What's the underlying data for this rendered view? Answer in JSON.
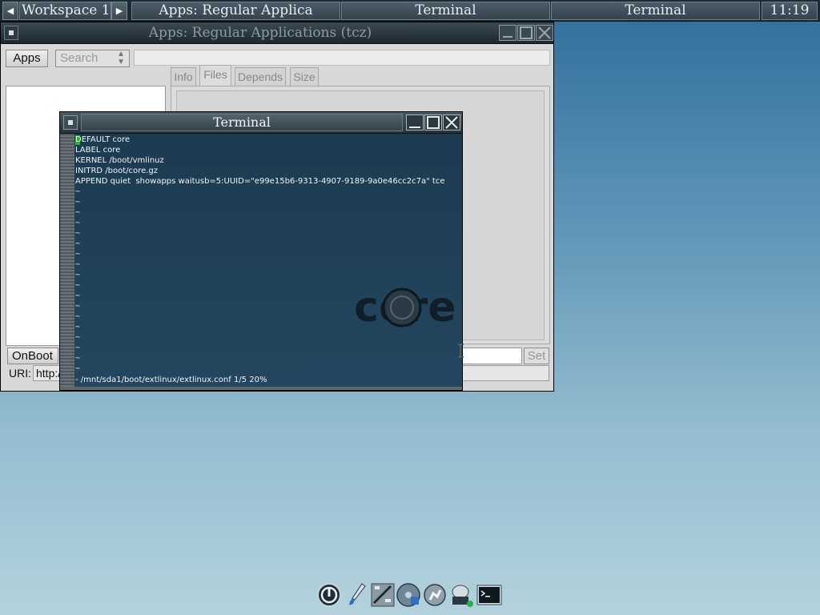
{
  "taskbar": {
    "workspace": "Workspace 1",
    "tasks": [
      "Apps: Regular Applica",
      "Terminal",
      "Terminal"
    ],
    "clock": "11:19"
  },
  "apps_window": {
    "title": "Apps: Regular Applications (tcz)",
    "apps_button": "Apps",
    "search_select": "Search",
    "tabs": [
      "Info",
      "Files",
      "Depends",
      "Size"
    ],
    "onboot_button": "OnBoot",
    "set_button": "Set",
    "uri_label": "URI:",
    "uri_value": "http:/"
  },
  "terminal": {
    "title": "Terminal",
    "lines": [
      "DEFAULT core",
      "LABEL core",
      "KERNEL /boot/vmlinuz",
      "INITRD /boot/core.gz",
      "APPEND quiet  showapps waitusb=5:UUID=\"e99e15b6-9313-4907-9189-9a0e46cc2c7a\" tce"
    ],
    "tilde": "~",
    "status": "- /mnt/sda1/boot/extlinux/extlinux.conf 1/5 20%",
    "logo_text": "core",
    "cursor_color": "#27b627"
  },
  "dock_icons": [
    "power-icon",
    "brush-icon",
    "control-panel-icon",
    "mount-tool-icon",
    "apps-audit-icon",
    "network-icon",
    "terminal-icon"
  ]
}
